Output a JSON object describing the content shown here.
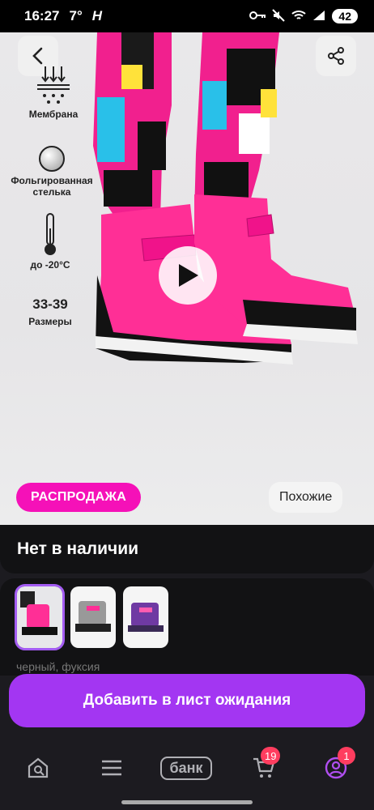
{
  "status_bar": {
    "time": "16:27",
    "temperature": "7°",
    "battery": "42"
  },
  "features": {
    "membrane": "Мембрана",
    "insole": "Фольгированная стелька",
    "temperature": "до -20°С",
    "sizes_value": "33-39",
    "sizes_label": "Размеры"
  },
  "badges": {
    "sale": "РАСПРОДАЖА",
    "similar": "Похожие"
  },
  "availability": "Нет в наличии",
  "color_name": "черный, фуксия",
  "wait_button": "Добавить в лист ожидания",
  "nav": {
    "bank": "банк",
    "cart_count": "19",
    "profile_count": "1"
  },
  "colors": {
    "accent": "#a336f2",
    "sale": "#f511b8",
    "badge": "#ff3d5f"
  }
}
